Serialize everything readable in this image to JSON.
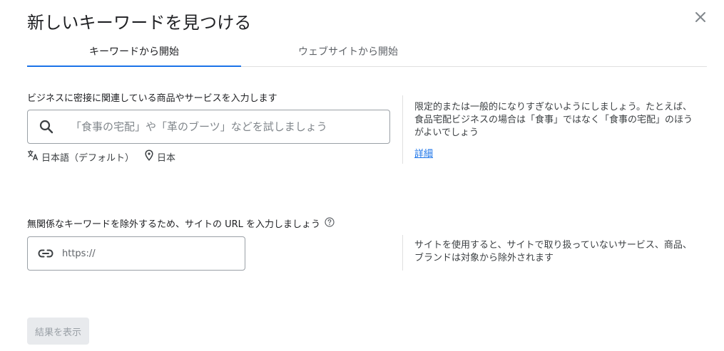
{
  "dialog": {
    "title": "新しいキーワードを見つける",
    "close_icon": "close-icon"
  },
  "tabs": [
    {
      "label": "キーワードから開始",
      "active": true
    },
    {
      "label": "ウェブサイトから開始",
      "active": false
    }
  ],
  "keyword_section": {
    "label": "ビジネスに密接に関連している商品やサービスを入力します",
    "search_icon": "search-icon",
    "placeholder": "「食事の宅配」や「革のブーツ」などを試しましょう",
    "language": "日本語（デフォルト）",
    "language_icon": "translate-icon",
    "location": "日本",
    "location_icon": "location-pin-icon",
    "help_text": "限定的または一般的になりすぎないようにしましょう。たとえば、食品宅配ビジネスの場合は「食事」ではなく「食事の宅配」のほうがよいでしょう",
    "help_link": "詳細"
  },
  "url_section": {
    "label": "無関係なキーワードを除外するため、サイトの URL を入力しましょう",
    "help_icon": "help-circle-icon",
    "link_icon": "link-icon",
    "placeholder": "https://",
    "help_text": "サイトを使用すると、サイトで取り扱っていないサービス、商品、ブランドは対象から除外されます"
  },
  "actions": {
    "submit_label": "結果を表示"
  },
  "colors": {
    "accent": "#1a73e8",
    "text_primary": "#202124",
    "text_secondary": "#5f6368",
    "border": "#9aa0a6",
    "disabled_bg": "#e8eaed"
  }
}
